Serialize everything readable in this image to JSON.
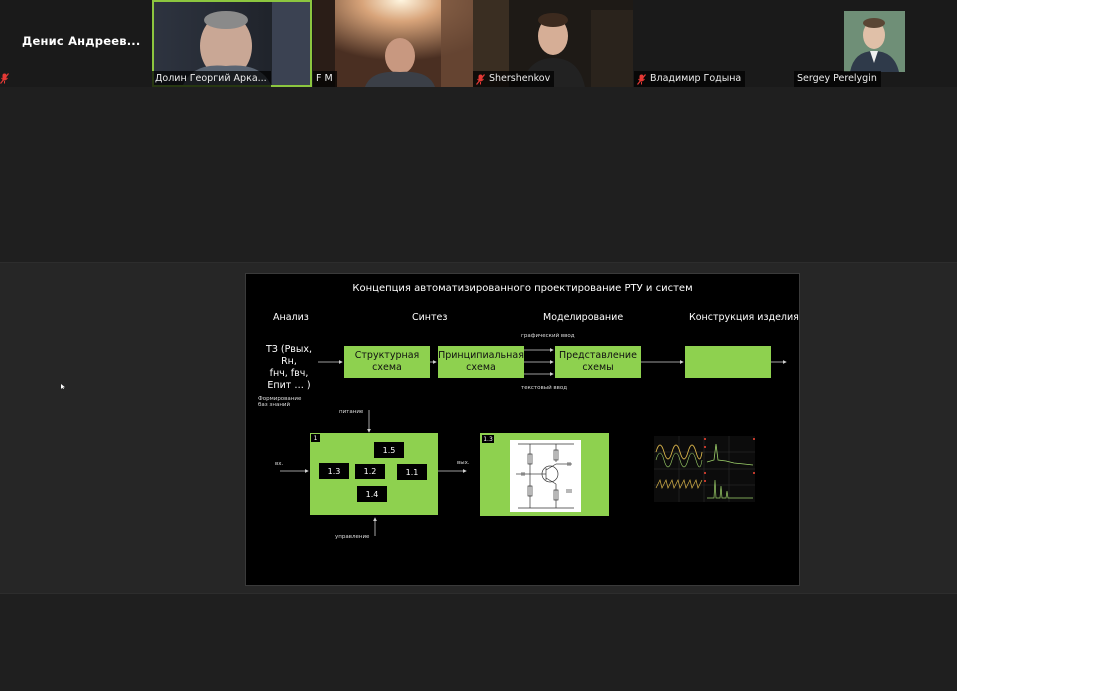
{
  "participants": [
    {
      "name": "Денис  Андреев...",
      "video": false,
      "muted": true
    },
    {
      "name": "Долин Георгий Арка...",
      "video": true,
      "muted": false,
      "active": true
    },
    {
      "name": "F M",
      "video": true,
      "muted": false
    },
    {
      "name": "Shershenkov",
      "video": true,
      "muted": true
    },
    {
      "name": "Владимир Годына",
      "video": false,
      "muted": true
    },
    {
      "name": "Sergey Perelygin",
      "video": true,
      "muted": false
    }
  ],
  "slide": {
    "title": "Концепция автоматизированного проектирование РТУ и систем",
    "sections": {
      "analysis": "Анализ",
      "synthesis": "Синтез",
      "modeling": "Моделирование",
      "construction": "Конструкция изделия"
    },
    "tz": {
      "line1": "ТЗ (Pвых, Rн,",
      "line2": "fнч, fвч,",
      "line3": "Eпит … )"
    },
    "boxes": {
      "structural": "Структурная схема",
      "principal": "Принципиальная схема",
      "representation": "Представление схемы",
      "construction": ""
    },
    "labels": {
      "graphic_input": "графический ввод",
      "text_input": "текстовый ввод",
      "formation_line1": "Формирование",
      "formation_line2": "баз знаний",
      "power": "питание",
      "control": "управление",
      "input": "вх.",
      "output": "вых."
    },
    "block": {
      "tag": "1",
      "b15": "1.5",
      "b13": "1.3",
      "b12": "1.2",
      "b11": "1.1",
      "b14": "1.4"
    },
    "circuit": {
      "tag": "1.3"
    }
  },
  "colors": {
    "accent_green": "#8ed14f",
    "active_speaker": "#8cc63f",
    "mute_red": "#e53935"
  }
}
